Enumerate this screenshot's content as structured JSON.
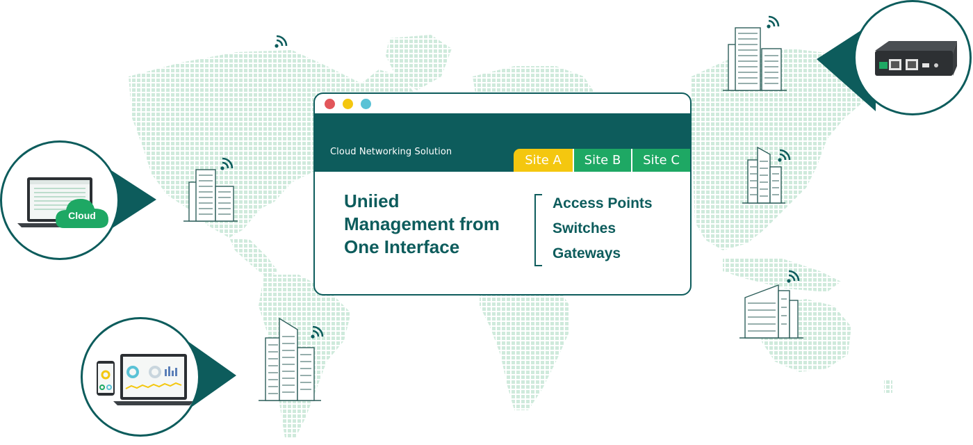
{
  "window": {
    "header_title": "Cloud Networking Solution",
    "tabs": [
      "Site A",
      "Site B",
      "Site C"
    ],
    "heading_lines": [
      "Uniied",
      "Management from",
      "One Interface"
    ],
    "features": [
      "Access Points",
      "Switches",
      "Gateways"
    ]
  },
  "callouts": {
    "cloud_label": "Cloud"
  },
  "icons": [
    "wifi-icon",
    "building-icon",
    "cloud-icon",
    "laptop-icon",
    "phone-icon",
    "controller-device-icon"
  ],
  "colors": {
    "primary": "#0d5c5c",
    "green": "#1ea864",
    "yellow": "#f4c70f",
    "map_dots": "#cfeadc",
    "dot_red": "#e2565a",
    "dot_blue": "#5ac2d6"
  }
}
